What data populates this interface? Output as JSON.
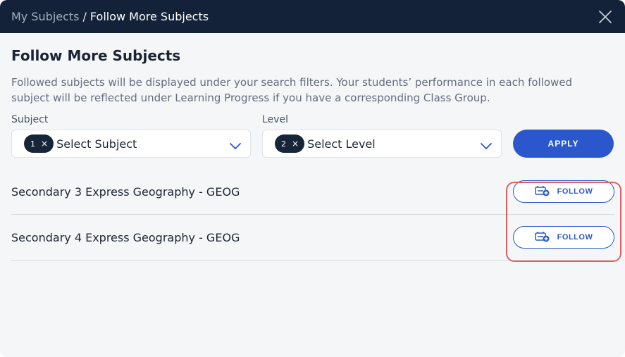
{
  "header": {
    "breadcrumb_parent": "My Subjects",
    "breadcrumb_separator": "/",
    "breadcrumb_current": "Follow More Subjects"
  },
  "page": {
    "title": "Follow More Subjects",
    "description": "Followed subjects will be displayed under your search filters. Your students’ performance in each followed subject will be reflected under Learning Progress if you have a corresponding Class Group."
  },
  "filters": {
    "subject": {
      "label": "Subject",
      "chip_count": "1",
      "chip_remove": "×",
      "placeholder": "Select Subject"
    },
    "level": {
      "label": "Level",
      "chip_count": "2",
      "chip_remove": "×",
      "placeholder": "Select Level"
    },
    "apply_label": "APPLY"
  },
  "subjects": [
    {
      "label": "Secondary 3 Express Geography - GEOG",
      "action_label": "FOLLOW"
    },
    {
      "label": "Secondary 4 Express Geography - GEOG",
      "action_label": "FOLLOW"
    }
  ],
  "colors": {
    "header_bg": "#132238",
    "accent": "#2a58cc",
    "highlight": "#e06060"
  },
  "icons": {
    "close": "close-icon",
    "chevron": "chevron-down-icon",
    "follow": "follow-subject-icon"
  }
}
